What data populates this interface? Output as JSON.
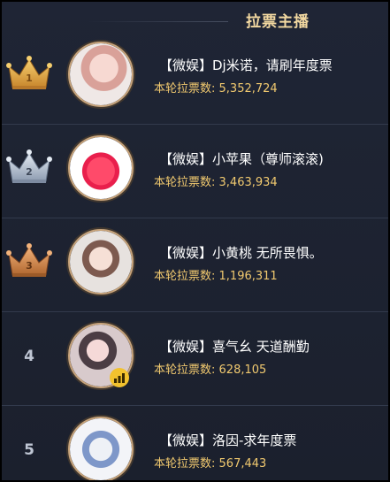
{
  "header": {
    "title": "拉票主播"
  },
  "colors": {
    "accent_gold": "#f1c96f",
    "title_color": "#f3d9a1",
    "background": "#1d2230",
    "crown_gold": "#e1a63d",
    "crown_silver": "#b6c3d3",
    "crown_bronze": "#d99156"
  },
  "streamers": [
    {
      "rank": "1",
      "rank_style": "gold-crown",
      "name": "【微娱】Dj米诺，请刷年度票",
      "votes_label": "本轮拉票数:",
      "votes_value": "5,352,724"
    },
    {
      "rank": "2",
      "rank_style": "silver-crown",
      "name": "【微娱】小苹果（尊师滚滚)",
      "votes_label": "本轮拉票数:",
      "votes_value": "3,463,934"
    },
    {
      "rank": "3",
      "rank_style": "bronze-crown",
      "name": "【微娱】小黄桃 无所畏惧。",
      "votes_label": "本轮拉票数:",
      "votes_value": "1,196,311"
    },
    {
      "rank": "4",
      "rank_style": "plain",
      "name": "【微娱】喜气幺 天道酬勤",
      "votes_label": "本轮拉票数:",
      "votes_value": "628,105",
      "badge_icon": "signal-bars-icon"
    },
    {
      "rank": "5",
      "rank_style": "plain",
      "name": "【微娱】洛因-求年度票",
      "votes_label": "本轮拉票数:",
      "votes_value": "567,443"
    }
  ]
}
